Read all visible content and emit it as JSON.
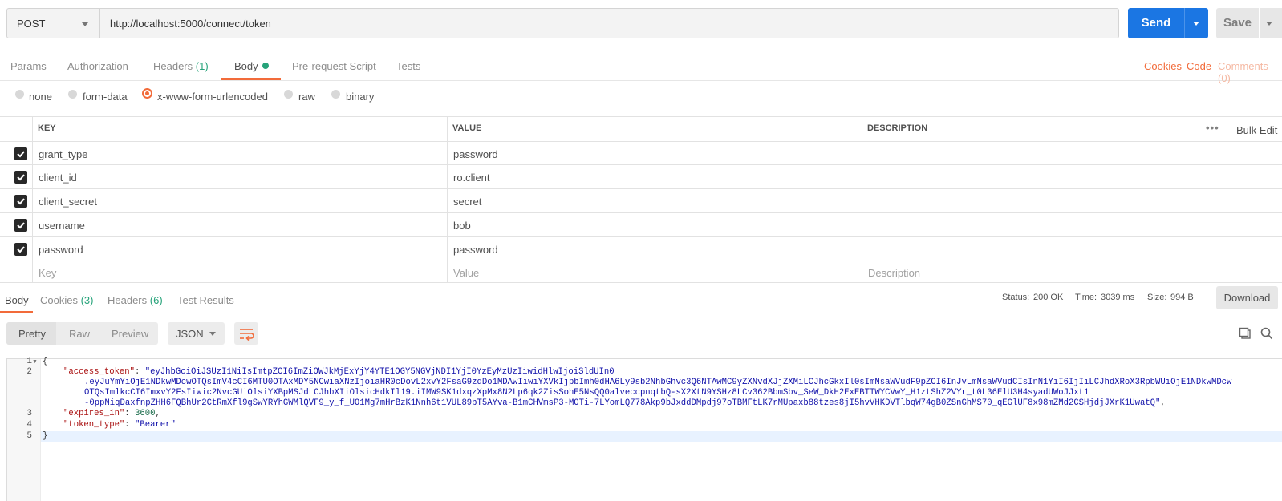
{
  "request": {
    "method": "POST",
    "url": "http://localhost:5000/connect/token",
    "send_label": "Send",
    "save_label": "Save"
  },
  "request_tabs": {
    "params": "Params",
    "authorization": "Authorization",
    "headers": "Headers",
    "headers_count": "(1)",
    "body": "Body",
    "prerequest": "Pre-request Script",
    "tests": "Tests",
    "cookies": "Cookies",
    "code": "Code",
    "comments": "Comments (0)"
  },
  "body_types": {
    "none": "none",
    "form_data": "form-data",
    "urlencoded": "x-www-form-urlencoded",
    "raw": "raw",
    "binary": "binary",
    "selected": "x-www-form-urlencoded"
  },
  "params_table": {
    "headers": {
      "key": "KEY",
      "value": "VALUE",
      "description": "DESCRIPTION",
      "bulk_edit": "Bulk Edit",
      "more": "•••"
    },
    "rows": [
      {
        "key": "grant_type",
        "value": "password",
        "checked": true
      },
      {
        "key": "client_id",
        "value": "ro.client",
        "checked": true
      },
      {
        "key": "client_secret",
        "value": "secret",
        "checked": true
      },
      {
        "key": "username",
        "value": "bob",
        "checked": true
      },
      {
        "key": "password",
        "value": "password",
        "checked": true
      }
    ],
    "placeholders": {
      "key": "Key",
      "value": "Value",
      "description": "Description"
    }
  },
  "response_tabs": {
    "body": "Body",
    "cookies": "Cookies",
    "cookies_count": "(3)",
    "headers": "Headers",
    "headers_count": "(6)",
    "test_results": "Test Results"
  },
  "response_meta": {
    "status_label": "Status:",
    "status": "200 OK",
    "time_label": "Time:",
    "time": "3039 ms",
    "size_label": "Size:",
    "size": "994 B",
    "download": "Download"
  },
  "view_modes": {
    "pretty": "Pretty",
    "raw": "Raw",
    "preview": "Preview",
    "format": "JSON"
  },
  "editor": {
    "line_numbers": [
      "1",
      "2",
      "3",
      "4",
      "5"
    ],
    "open_brace": "{",
    "close_brace": "}",
    "access_token_key": "\"access_token\"",
    "token_line1": "\"eyJhbGciOiJSUzI1NiIsImtpZCI6ImZiOWJkMjExYjY4YTE1OGY5NGVjNDI1YjI0YzEyMzUzIiwidHlwIjoiSldUIn0",
    "token_line2": ".eyJuYmYiOjE1NDkwMDcwOTQsImV4cCI6MTU0OTAxMDY5NCwiaXNzIjoiaHR0cDovL2xvY2FsaG9zdDo1MDAwIiwiYXVkIjpbImh0dHA6Ly9sb2NhbGhvc3Q6NTAwMC9yZXNvdXJjZXMiLCJhcGkxIl0sImNsaWVudF9pZCI6InJvLmNsaWVudCIsInN1YiI6IjIiLCJhdXRoX3RpbWUiOjE1NDkwMDcw",
    "token_line3": "OTQsImlkcCI6ImxvY2FsIiwic2NvcGUiOlsiYXBpMSJdLCJhbXIiOlsicHdkIl19.iIMW9SK1dxqzXpMx8N2Lp6qk2ZisSohE5NsQQ0alveccpnqtbQ-sX2XtN9YSHz8LCv362BbmSbv_SeW_DkH2ExEBTIWYCVwY_H1ztShZ2VYr_t0L36ElU3H4syadUWoJJxt1",
    "token_line4": "-0ppNiqDaxfnpZHH6FQBhUr2CtRmXfl9gSwYRYhGWMlQVF9_y_f_UO1Mg7mHrBzK1Nnh6t1VUL89bT5AYva-B1mCHVmsP3-MOTi-7LYomLQ778Akp9bJxddDMpdj97oTBMFtLK7rMUpaxb88tzes8jI5hvVHKDVTlbqW74gB0ZSnGhMS70_qEGlUF8x98mZMd2CSHjdjJXrK1UwatQ\"",
    "expires_key": "\"expires_in\"",
    "expires_value": "3600",
    "token_type_key": "\"token_type\"",
    "token_type_value": "\"Bearer\""
  },
  "colors": {
    "accent": "#f26b3a",
    "send": "#1b76e3",
    "success": "#26a37a"
  }
}
